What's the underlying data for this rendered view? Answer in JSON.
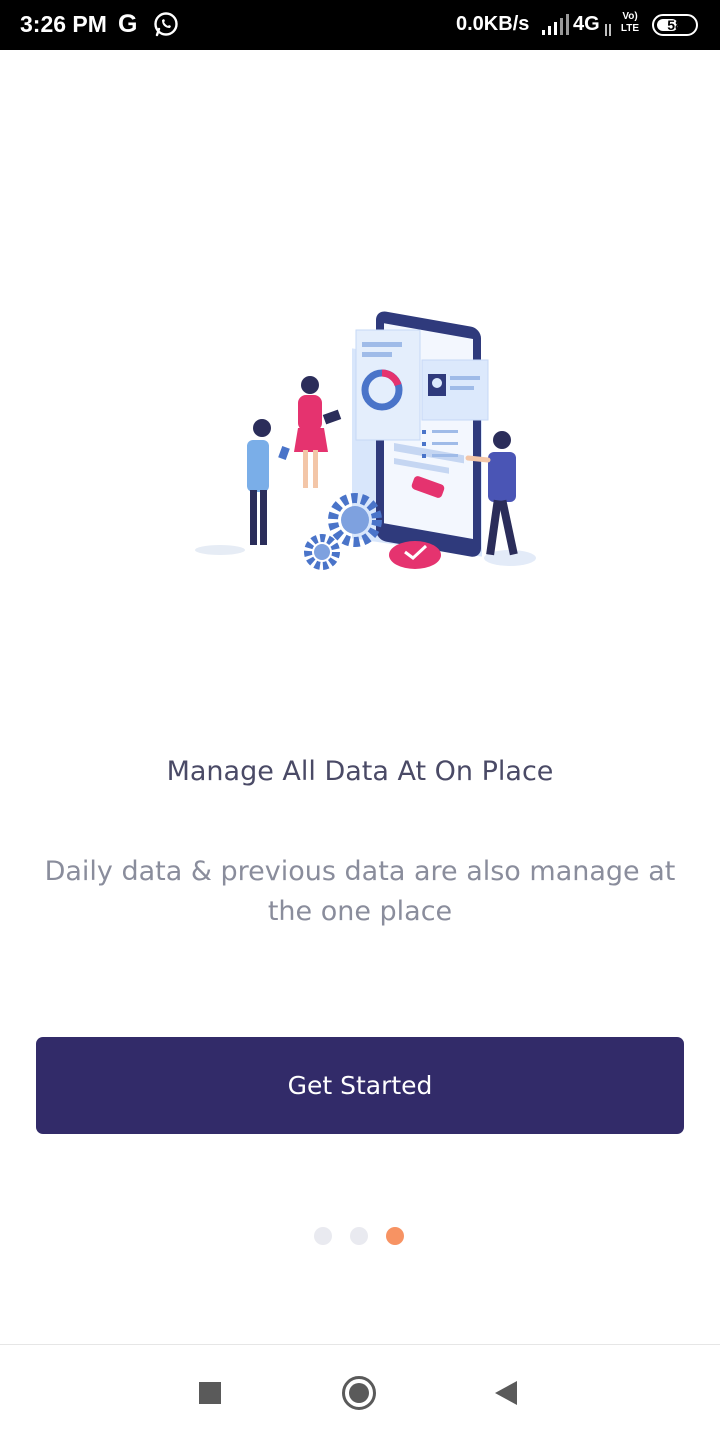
{
  "status_bar": {
    "time": "3:26 PM",
    "google_label": "G",
    "speed": "0.0KB/s",
    "network": "4G",
    "volte_top": "Vo)",
    "volte_bottom": "LTE",
    "battery": "58",
    "battery_fraction": 0.58
  },
  "illustration": {
    "icon": "data-management-illustration"
  },
  "onboarding": {
    "title": "Manage All Data At On Place",
    "subtitle": "Daily data & previous data are also manage at the one place",
    "cta_label": "Get Started",
    "page_count": 3,
    "active_page": 3
  },
  "colors": {
    "primary": "#322b69",
    "active_dot": "#f79363",
    "inactive_dot": "#e9eaf0",
    "title_text": "#4a4a66",
    "subtitle_text": "#8a8d9c",
    "accent_pink": "#e5336f",
    "accent_blue": "#4a74c9"
  }
}
